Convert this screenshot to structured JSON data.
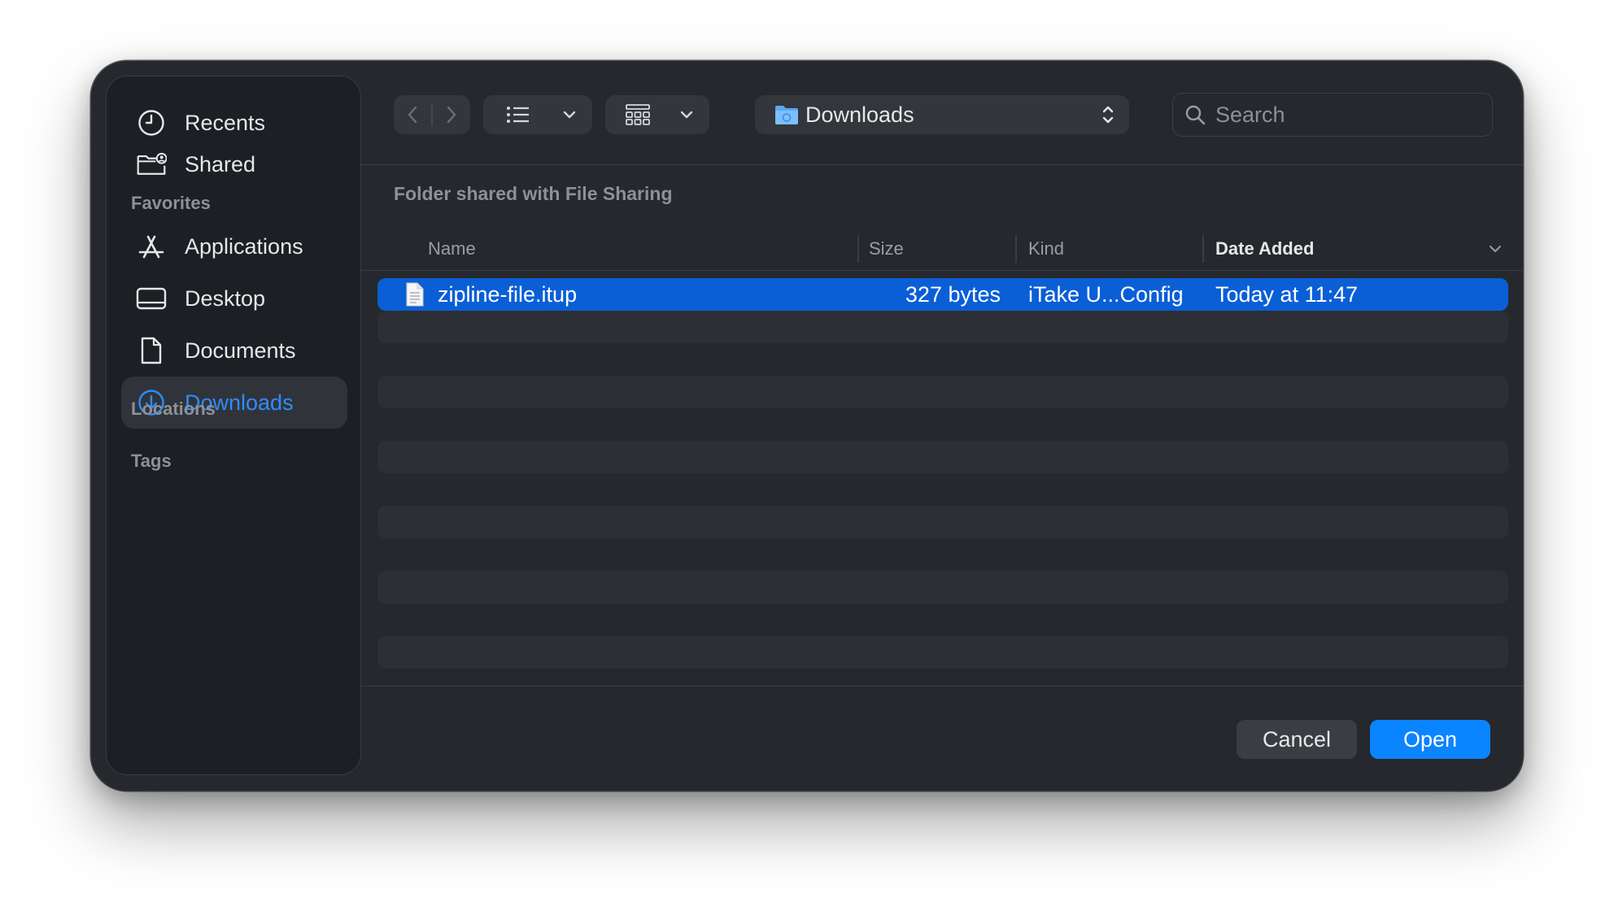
{
  "sidebar": {
    "items": [
      {
        "label": "Recents",
        "icon": "clock-icon"
      },
      {
        "label": "Shared",
        "icon": "shared-folder-icon"
      }
    ],
    "favorites_heading": "Favorites",
    "favorites": [
      {
        "label": "Applications",
        "icon": "applications-icon"
      },
      {
        "label": "Desktop",
        "icon": "desktop-icon"
      },
      {
        "label": "Documents",
        "icon": "document-icon"
      },
      {
        "label": "Downloads",
        "icon": "download-icon",
        "selected": true
      }
    ],
    "locations_heading": "Locations",
    "tags_heading": "Tags"
  },
  "toolbar": {
    "location": "Downloads",
    "search_placeholder": "Search"
  },
  "folder_label": "Folder shared with File Sharing",
  "columns": {
    "name": "Name",
    "size": "Size",
    "kind": "Kind",
    "date_added": "Date Added"
  },
  "files": [
    {
      "name": "zipline-file.itup",
      "size": "327 bytes",
      "kind": "iTake U...Config",
      "date_added": "Today at 11:47",
      "selected": true
    }
  ],
  "footer": {
    "cancel_label": "Cancel",
    "open_label": "Open"
  },
  "colors": {
    "accent": "#0b84ff",
    "selection": "#0a5fd6",
    "sidebar_selected_text": "#2f8cff"
  }
}
